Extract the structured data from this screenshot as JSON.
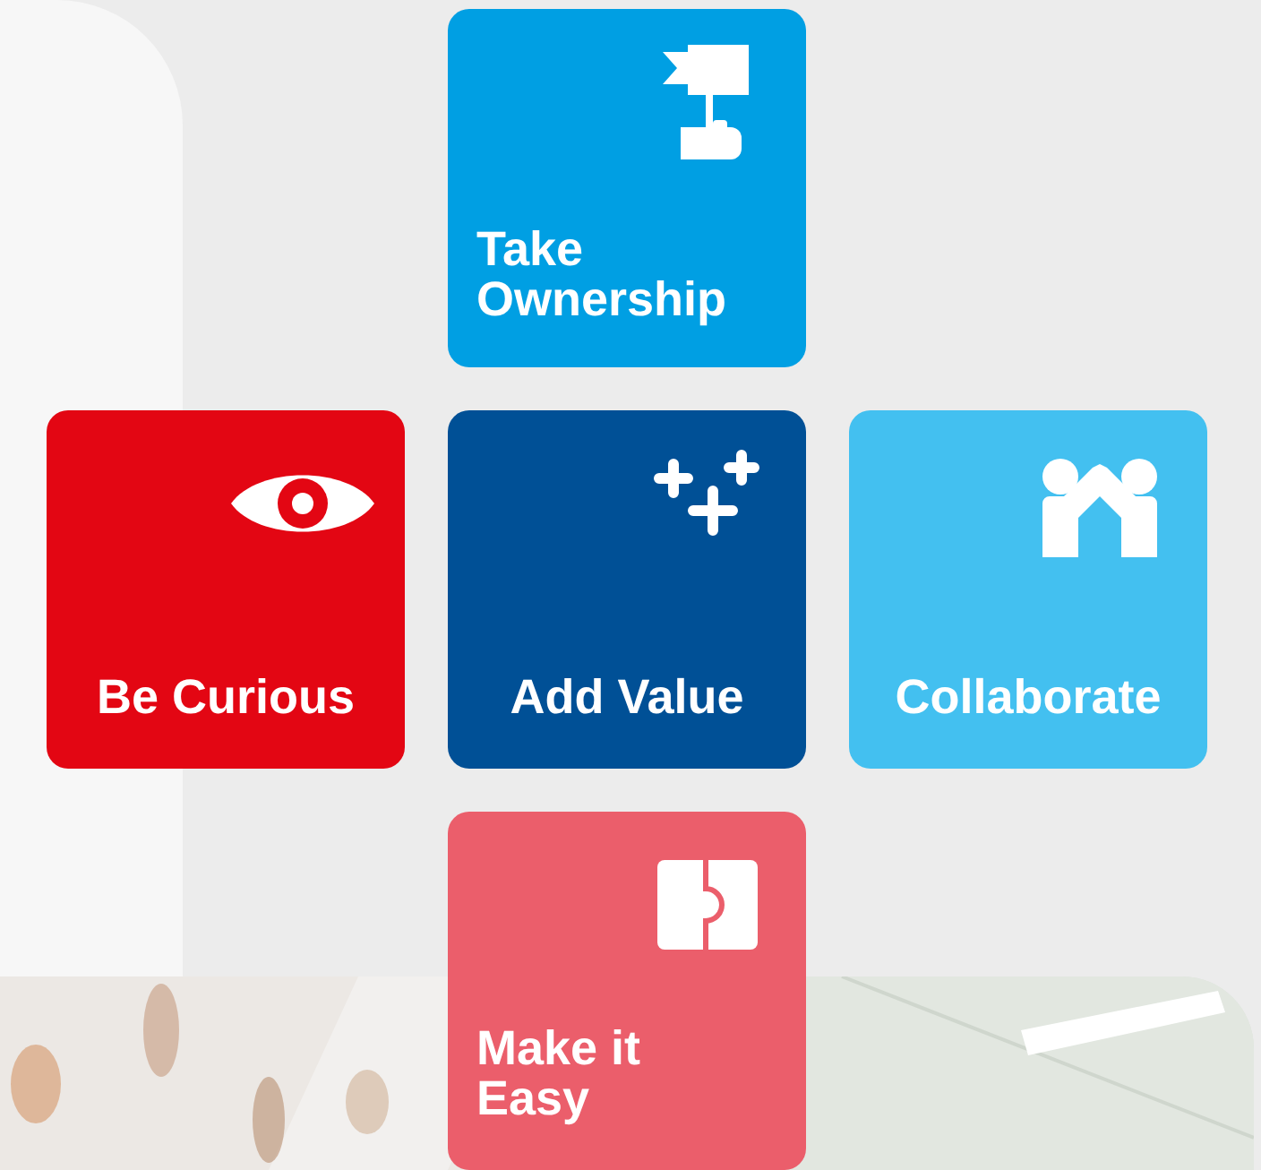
{
  "values": [
    {
      "label": "Take Ownership",
      "color": "#009fe3"
    },
    {
      "label": "Be Curious",
      "color": "#e30613"
    },
    {
      "label": "Add Value",
      "color": "#005096"
    },
    {
      "label": "Collaborate",
      "color": "#43c0f0"
    },
    {
      "label": "Make it Easy",
      "color": "#eb5e6b"
    }
  ]
}
